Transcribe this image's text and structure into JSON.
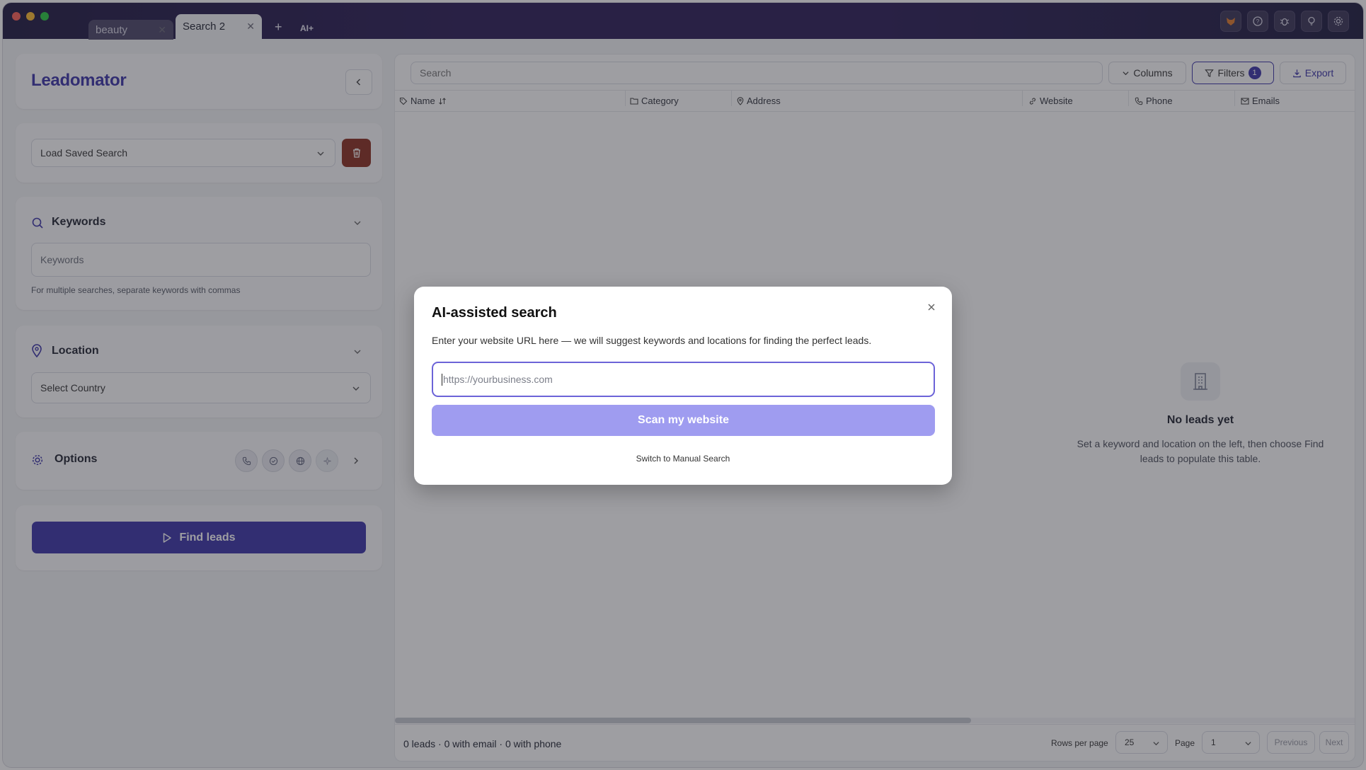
{
  "titlebar": {
    "tabs": [
      {
        "label": "beauty",
        "active": false
      },
      {
        "label": "Search 2",
        "active": true
      }
    ],
    "new_tab_symbol": "+",
    "ai_button": "AI+",
    "right_icons": [
      "fox-icon",
      "help-icon",
      "bug-icon",
      "lightbulb-icon",
      "gear-icon"
    ]
  },
  "sidebar": {
    "app_name": "Leadomator",
    "saved_search": {
      "placeholder": "Load Saved Search"
    },
    "keywords": {
      "heading": "Keywords",
      "placeholder": "Keywords",
      "hint": "For multiple searches, separate keywords with commas"
    },
    "location": {
      "heading": "Location",
      "country_placeholder": "Select Country"
    },
    "options": {
      "heading": "Options",
      "icons": [
        "phone-icon",
        "check-circle-icon",
        "globe-icon",
        "sparkle-icon"
      ]
    },
    "find_button": "Find leads"
  },
  "table": {
    "search_placeholder": "Search",
    "columns_button": "Columns",
    "filters_button": "Filters",
    "filters_count": "1",
    "export_button": "Export",
    "columns": [
      "Name",
      "Category",
      "Address",
      "Website",
      "Phone",
      "Emails"
    ],
    "empty_title": "No leads yet",
    "empty_text_line1": "Set a keyword and location on the left, then choose Find",
    "empty_text_line2": "leads to populate this table.",
    "summary": "0 leads · 0 with email · 0 with phone",
    "rows_per_page_label": "Rows per page",
    "rows_per_page_value": "25",
    "page_label": "Page",
    "page_value": "1",
    "prev_button": "Previous",
    "next_button": "Next",
    "horizontal_scroll_fraction": 0.6
  },
  "modal": {
    "title": "AI-assisted search",
    "description": "Enter your website URL here — we will suggest keywords and locations for finding the perfect leads.",
    "url_placeholder": "https://yourbusiness.com",
    "scan_button": "Scan my website",
    "switch_link": "Switch to Manual Search"
  },
  "colors": {
    "brand": "#3b34a8",
    "find_button": "#3b34a8",
    "scan_button": "#9f9cf0",
    "delete_button": "#8a2f1f",
    "filter_badge": "#3b34a8"
  }
}
